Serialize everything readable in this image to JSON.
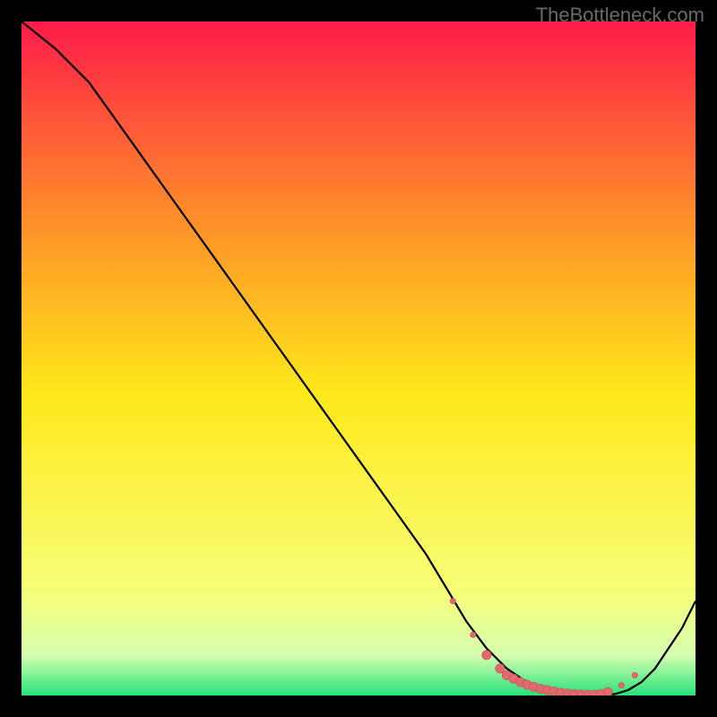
{
  "watermark": "TheBottleneck.com",
  "colors": {
    "bg": "#000000",
    "curve": "#000000",
    "dotFill": "#e2696d",
    "dotStroke": "#d25a5e",
    "gradTop": "#ff1b4a",
    "gradMidTop": "#ff8a2a",
    "gradMid": "#ffe81a",
    "gradMidBot": "#f6ff7a",
    "gradBot1": "#d6ffb0",
    "gradBot2": "#28e27a"
  },
  "chart_data": {
    "type": "line",
    "title": "",
    "xlabel": "",
    "ylabel": "",
    "xlim": [
      0,
      100
    ],
    "ylim": [
      0,
      100
    ],
    "series": [
      {
        "name": "curve",
        "x": [
          0,
          5,
          10,
          15,
          20,
          25,
          30,
          35,
          40,
          45,
          50,
          55,
          60,
          63,
          66,
          69,
          72,
          75,
          78,
          80,
          82,
          84,
          86,
          88,
          90,
          92,
          94,
          96,
          98,
          100
        ],
        "y": [
          100,
          96,
          91,
          84,
          77,
          70,
          63,
          56,
          49,
          42,
          35,
          28,
          21,
          16,
          11,
          7,
          4,
          2,
          1,
          0.5,
          0.2,
          0.1,
          0.1,
          0.2,
          0.8,
          2,
          4,
          7,
          10,
          14
        ]
      }
    ],
    "highlight_dots": {
      "x": [
        64,
        67,
        69,
        71,
        72,
        73,
        74,
        75,
        76,
        77,
        78,
        79,
        80,
        81,
        82,
        83,
        84,
        85,
        86,
        87,
        89,
        91
      ],
      "y": [
        14,
        9,
        6,
        4,
        3,
        2.5,
        2,
        1.6,
        1.3,
        1.0,
        0.8,
        0.6,
        0.4,
        0.3,
        0.2,
        0.15,
        0.12,
        0.12,
        0.2,
        0.5,
        1.5,
        3
      ],
      "r": [
        3,
        3,
        5,
        5,
        5,
        5,
        5,
        5,
        5,
        5,
        5,
        5,
        5,
        5,
        5,
        5,
        5,
        5,
        5,
        5,
        3,
        3
      ]
    },
    "gradient_stops": [
      {
        "offset": 0.0,
        "key": "gradTop"
      },
      {
        "offset": 0.28,
        "key": "gradMidTop"
      },
      {
        "offset": 0.55,
        "key": "gradMid"
      },
      {
        "offset": 0.85,
        "key": "gradMidBot"
      },
      {
        "offset": 0.94,
        "key": "gradBot1"
      },
      {
        "offset": 1.0,
        "key": "gradBot2"
      }
    ]
  }
}
